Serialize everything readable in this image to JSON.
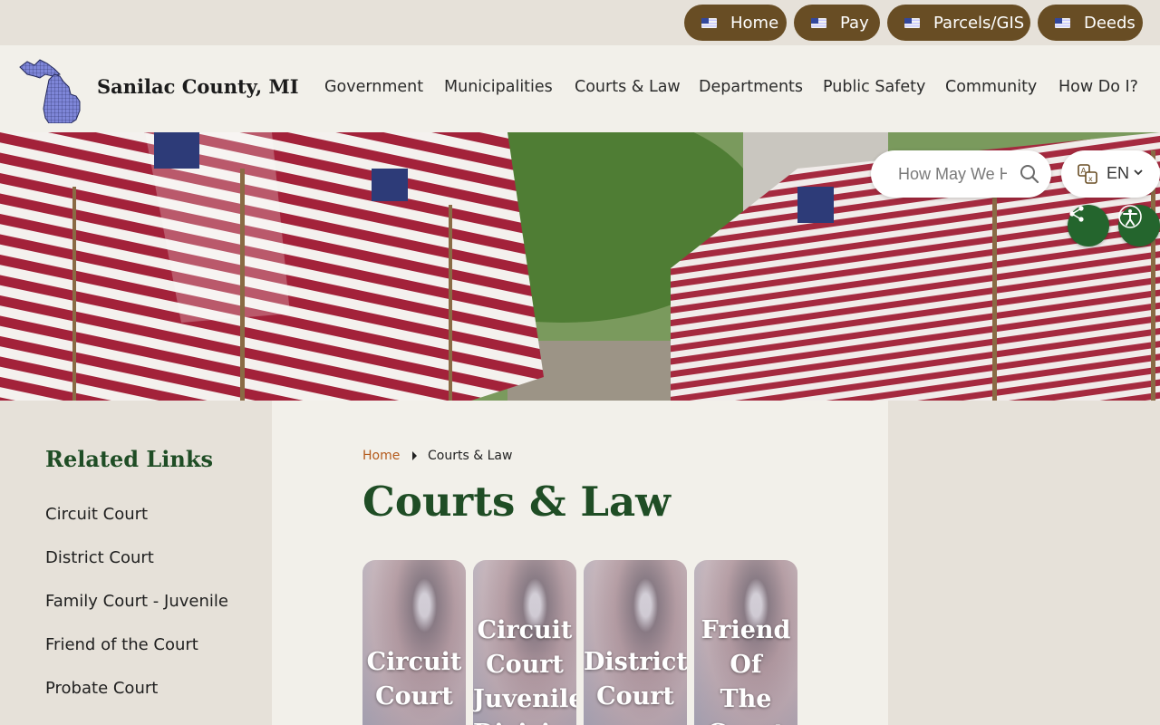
{
  "quick_links": [
    {
      "label": "Home"
    },
    {
      "label": "Pay"
    },
    {
      "label": "Parcels/GIS"
    },
    {
      "label": "Deeds"
    }
  ],
  "site": {
    "name": "Sanilac County, MI"
  },
  "nav": [
    {
      "label": "Government"
    },
    {
      "label": "Municipalities"
    },
    {
      "label": "Courts & Law"
    },
    {
      "label": "Departments"
    },
    {
      "label": "Public Safety"
    },
    {
      "label": "Community"
    },
    {
      "label": "How Do I?"
    }
  ],
  "search": {
    "placeholder": "How May We Help You?"
  },
  "language": {
    "code": "EN"
  },
  "sidebar": {
    "title": "Related Links",
    "links": [
      {
        "label": "Circuit Court"
      },
      {
        "label": "District Court"
      },
      {
        "label": "Family Court - Juvenile"
      },
      {
        "label": "Friend of the Court"
      },
      {
        "label": "Probate Court"
      }
    ]
  },
  "breadcrumb": {
    "home": "Home",
    "current": "Courts & Law"
  },
  "page": {
    "title": "Courts & Law"
  },
  "cards": [
    {
      "lines": [
        "Circuit",
        "Court"
      ]
    },
    {
      "lines": [
        "Circuit",
        "Court",
        "Juvenile",
        "Division"
      ]
    },
    {
      "lines": [
        "District",
        "Court"
      ]
    },
    {
      "lines": [
        "Friend",
        "Of",
        "The",
        "Court"
      ]
    }
  ],
  "colors": {
    "brown": "#684d24",
    "green": "#1f4d25",
    "accent": "#b45a1b"
  }
}
